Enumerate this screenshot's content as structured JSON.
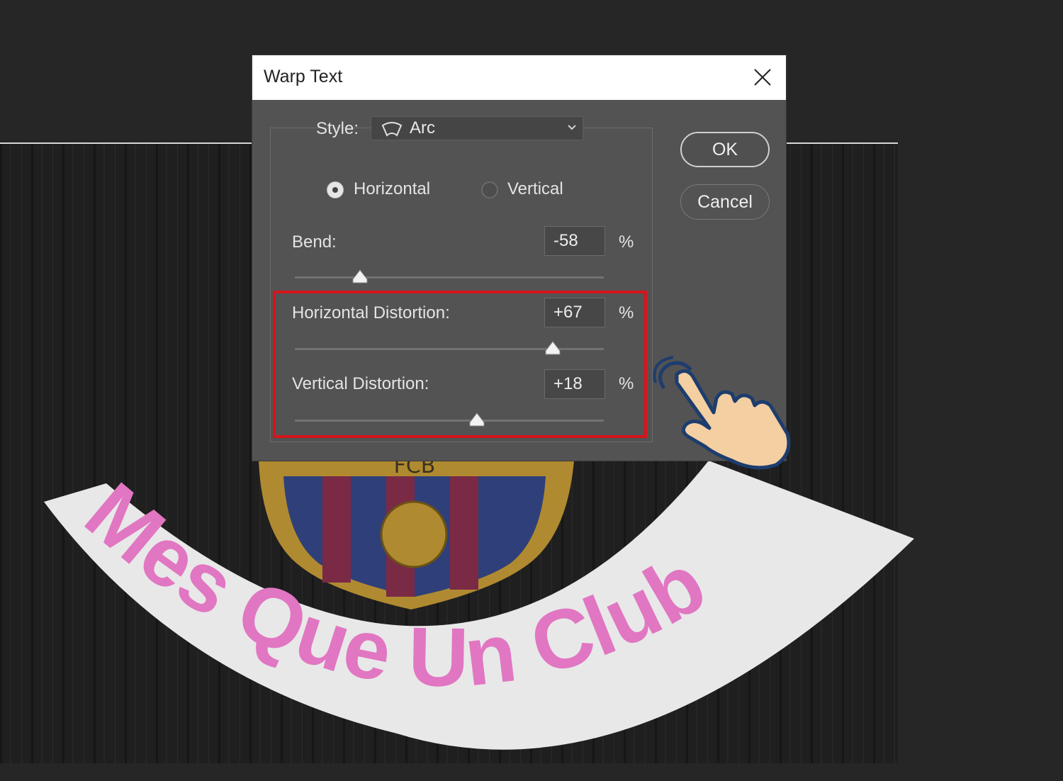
{
  "canvas": {
    "artwork_text": "Mes Que Un Club",
    "crest_text": "FCB",
    "colors": {
      "text": "#e176c2",
      "band": "#e8e8e8",
      "wood": "#1e1e1e"
    }
  },
  "dialog": {
    "title": "Warp Text",
    "close_icon": "close-icon",
    "style_label": "Style:",
    "style_value": "Arc",
    "style_icon": "arc-icon",
    "orientation": {
      "horizontal_label": "Horizontal",
      "vertical_label": "Vertical",
      "selected": "Horizontal"
    },
    "bend": {
      "label": "Bend:",
      "value": "-58",
      "unit": "%",
      "numeric": -58
    },
    "horizontal_distortion": {
      "label": "Horizontal Distortion:",
      "value": "+67",
      "unit": "%",
      "numeric": 67
    },
    "vertical_distortion": {
      "label": "Vertical Distortion:",
      "value": "+18",
      "unit": "%",
      "numeric": 18
    },
    "buttons": {
      "ok": "OK",
      "cancel": "Cancel"
    }
  },
  "annotation": {
    "highlight_color": "#d6141b",
    "pointer_icon": "hand-pointer-icon"
  }
}
